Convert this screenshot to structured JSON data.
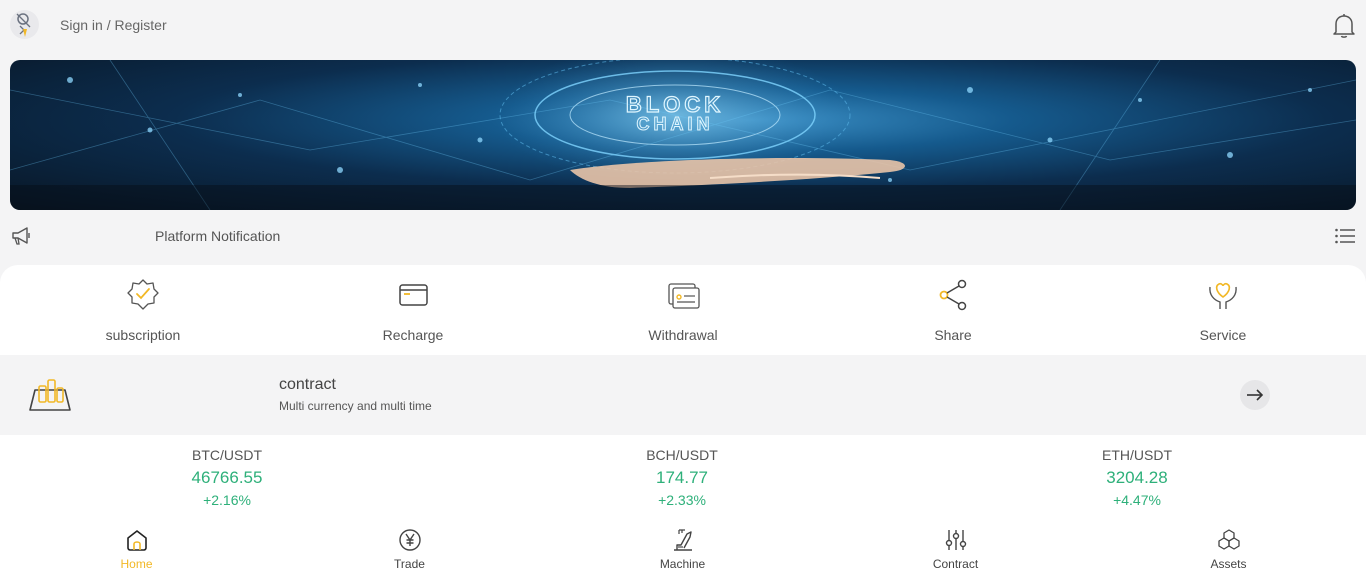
{
  "header": {
    "signin_label": "Sign in / Register",
    "avatar_icon": "user-avatar-icon",
    "bell_icon": "bell-icon"
  },
  "banner": {
    "title_line1": "BLOCK",
    "title_line2": "CHAIN"
  },
  "notification": {
    "text": "Platform Notification",
    "left_icon": "megaphone-icon",
    "right_icon": "list-icon"
  },
  "menu": {
    "items": [
      {
        "label": "subscription",
        "icon": "badge-check-icon"
      },
      {
        "label": "Recharge",
        "icon": "card-icon"
      },
      {
        "label": "Withdrawal",
        "icon": "withdraw-card-icon"
      },
      {
        "label": "Share",
        "icon": "share-icon"
      },
      {
        "label": "Service",
        "icon": "heart-hand-icon"
      }
    ]
  },
  "contract": {
    "title": "contract",
    "subtitle": "Multi currency and multi time",
    "icon": "bars-box-icon",
    "arrow_icon": "arrow-right-icon"
  },
  "tickers": [
    {
      "pair": "BTC/USDT",
      "price": "46766.55",
      "change": "+2.16%"
    },
    {
      "pair": "BCH/USDT",
      "price": "174.77",
      "change": "+2.33%"
    },
    {
      "pair": "ETH/USDT",
      "price": "3204.28",
      "change": "+4.47%"
    }
  ],
  "tabs": [
    {
      "label": "Home",
      "icon": "home-icon",
      "active": true
    },
    {
      "label": "Trade",
      "icon": "yen-circle-icon",
      "active": false
    },
    {
      "label": "Machine",
      "icon": "machine-icon",
      "active": false
    },
    {
      "label": "Contract",
      "icon": "sliders-icon",
      "active": false
    },
    {
      "label": "Assets",
      "icon": "cubes-icon",
      "active": false
    }
  ],
  "colors": {
    "accent": "#f2b826",
    "positive": "#2eb07a",
    "background": "#f4f4f5"
  }
}
